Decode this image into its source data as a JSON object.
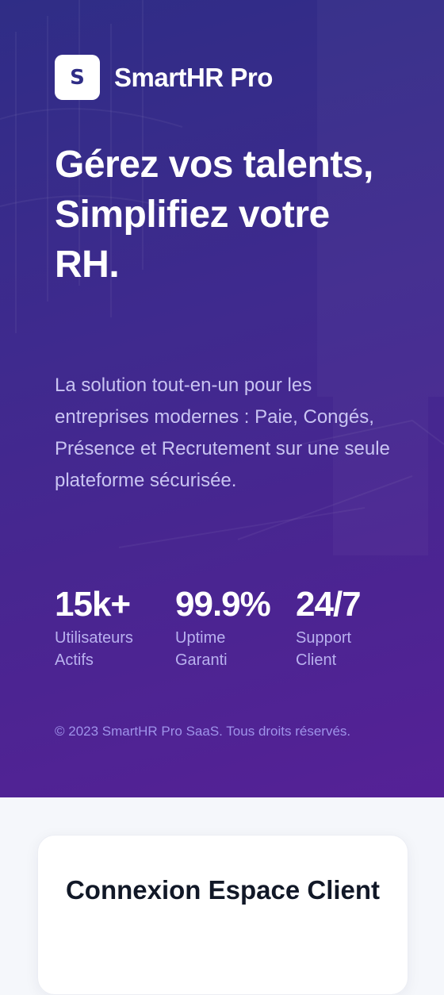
{
  "brand": {
    "logo_letter": "S",
    "name": "SmartHR Pro"
  },
  "hero": {
    "headline": "Gérez vos talents, Simplifiez votre RH.",
    "subtitle": "La solution tout-en-un pour les entreprises modernes : Paie, Congés, Présence et Recrutement sur une seule plateforme sécurisée.",
    "stats": [
      {
        "value": "15k+",
        "label": "Utilisateurs Actifs"
      },
      {
        "value": "99.9%",
        "label": "Uptime Garanti"
      },
      {
        "value": "24/7",
        "label": "Support Client"
      }
    ],
    "copyright": "© 2023 SmartHR Pro SaaS. Tous droits réservés."
  },
  "login_card": {
    "title": "Connexion Espace Client"
  },
  "colors": {
    "hero_gradient_start": "#2f2d86",
    "hero_gradient_end": "#552196",
    "page_background": "#f5f7fb",
    "card_background": "#ffffff",
    "subtitle_text": "#c9c4f2",
    "title_text": "#111827"
  }
}
